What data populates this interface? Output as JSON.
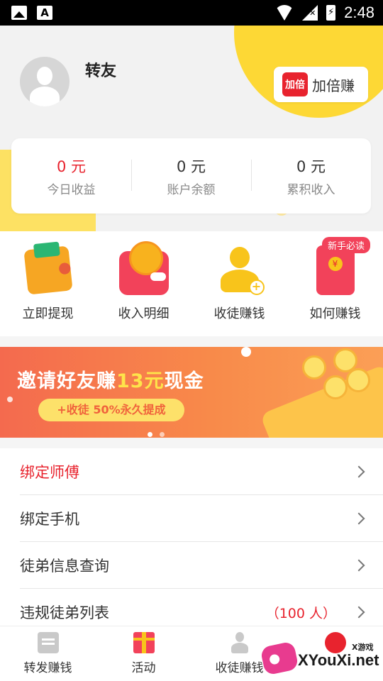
{
  "status_bar": {
    "time": "2:48",
    "left_icons": [
      "image-icon",
      "a-font-icon"
    ],
    "right_icons": [
      "wifi-icon",
      "no-signal-icon",
      "battery-charging-icon"
    ]
  },
  "profile": {
    "username": "转友",
    "double_earn_badge": "加倍",
    "double_earn_label": "加倍赚"
  },
  "stats": [
    {
      "value": "0 元",
      "label": "今日收益"
    },
    {
      "value": "0 元",
      "label": "账户余额"
    },
    {
      "value": "0 元",
      "label": "累积收入"
    }
  ],
  "shortcuts": [
    {
      "label": "立即提现",
      "icon": "wallet-icon"
    },
    {
      "label": "收入明细",
      "icon": "purse-icon"
    },
    {
      "label": "收徒赚钱",
      "icon": "add-user-icon"
    },
    {
      "label": "如何赚钱",
      "icon": "red-envelope-icon",
      "badge": "新手必读"
    }
  ],
  "banner": {
    "title_prefix": "邀请好友赚",
    "title_highlight": "13元",
    "title_suffix": "现金",
    "pill": "+收徒 50%永久提成"
  },
  "menu": [
    {
      "label": "绑定师傅",
      "highlight": true
    },
    {
      "label": "绑定手机"
    },
    {
      "label": "徒弟信息查询"
    },
    {
      "label": "违规徒弟列表",
      "extra": "（100 人）"
    }
  ],
  "bottom_nav": [
    {
      "label": "转发赚钱",
      "icon": "article-icon"
    },
    {
      "label": "活动",
      "icon": "gift-icon"
    },
    {
      "label": "收徒赚钱",
      "icon": "user-icon"
    },
    {
      "label": "",
      "icon": "mine-icon"
    }
  ],
  "watermark": {
    "text": "XYouXi.net",
    "small": "X游戏"
  },
  "colors": {
    "accent_red": "#e8232e",
    "accent_yellow": "#fdd835",
    "banner_orange": "#f88a4a"
  }
}
